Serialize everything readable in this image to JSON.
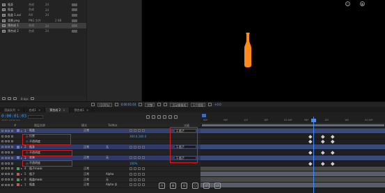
{
  "project": {
    "items": [
      {
        "name": "瓶身",
        "type": "合成",
        "num": "24",
        "size": "",
        "selected": false
      },
      {
        "name": "瓶盖",
        "type": "合成",
        "num": "24",
        "size": "",
        "selected": false
      },
      {
        "name": "瓶盖 1.avi",
        "type": "AVI",
        "num": "24",
        "size": "",
        "selected": false
      },
      {
        "name": "背景.png",
        "type": "PNG 文件",
        "num": "",
        "size": "2 KB",
        "selected": false
      },
      {
        "name": "预合成 1",
        "type": "合成",
        "num": "24",
        "size": "",
        "selected": true
      },
      {
        "name": "预合成 2",
        "type": "合成",
        "num": "24",
        "size": "",
        "selected": false
      }
    ],
    "bpc": "8 bpc"
  },
  "viewer_bar": {
    "zoom": "(100%)",
    "time": "0:00:01:03",
    "quality": "完整",
    "camera": "活动摄像机",
    "views": "1个视图",
    "value": "+0.0"
  },
  "tabs": [
    {
      "label": "渲染队列",
      "active": false
    },
    {
      "label": "合成1",
      "active": false
    },
    {
      "label": "预合成 2",
      "active": true
    },
    {
      "label": "预合成1",
      "active": false
    }
  ],
  "timeline": {
    "timecode": "0:00:01:03",
    "timecode_sub": "00027 (24.00 fps)",
    "columns": {
      "num": "#",
      "name": "图层名称",
      "mode": "模式",
      "trkmat": "TrkMat",
      "parent": "父级"
    },
    "layers": [
      {
        "num": "1",
        "name": "瓶盖",
        "mode": "正常",
        "trk": "",
        "parent": "1.瓶子",
        "row_class": "hl2",
        "label_color": "#6c7ad6",
        "is_prop": false
      },
      {
        "num": "",
        "name": "位置",
        "mode": "",
        "trk": "",
        "value": "360.0,180.0",
        "parent": "",
        "row_class": "prop",
        "is_prop": true
      },
      {
        "num": "",
        "name": "不透明度",
        "mode": "",
        "trk": "",
        "value": "",
        "parent": "",
        "row_class": "prop",
        "is_prop": true
      },
      {
        "num": "2",
        "name": "瓶身",
        "mode": "正常",
        "trk": "无",
        "parent": "1.瓶子",
        "row_class": "hl",
        "label_color": "#6c7ad6",
        "is_prop": false
      },
      {
        "num": "",
        "name": "不透明度",
        "mode": "",
        "trk": "",
        "value": "",
        "parent": "",
        "row_class": "prop",
        "is_prop": true
      },
      {
        "num": "3",
        "name": "背景",
        "mode": "正常",
        "trk": "无",
        "parent": "1.瓶子",
        "row_class": "hl",
        "label_color": "#6c7ad6",
        "is_prop": false
      },
      {
        "num": "",
        "name": "不透明度",
        "mode": "",
        "trk": "",
        "value": "100%",
        "parent": "",
        "row_class": "prop",
        "is_prop": true
      },
      {
        "num": "4",
        "name": "瓶子mask",
        "mode": "正常",
        "trk": "",
        "parent": "",
        "row_class": "",
        "label_color": "#4f9a5e",
        "is_prop": false
      },
      {
        "num": "5",
        "name": "瓶子",
        "mode": "正常",
        "trk": "Alpha",
        "parent": "",
        "row_class": "",
        "label_color": "#c25a5a",
        "is_prop": false
      },
      {
        "num": "6",
        "name": "瓶盖mask",
        "mode": "正常",
        "trk": "无",
        "parent": "",
        "row_class": "",
        "label_color": "#4f9a5e",
        "is_prop": false
      },
      {
        "num": "7",
        "name": "瓶盖",
        "mode": "正常",
        "trk": "Alpha 反",
        "parent": "",
        "row_class": "",
        "label_color": "#c25a5a",
        "is_prop": false
      }
    ],
    "ruler_ticks": [
      "00f",
      "06f",
      "12f",
      "18f",
      "01:00f",
      "06f",
      "12f",
      "18f",
      "02:00f"
    ]
  },
  "colors": {
    "accent_blue": "#3aa3ff",
    "bottle_orange": "#ff8a1c",
    "highlight_box": "#e11b1b"
  }
}
